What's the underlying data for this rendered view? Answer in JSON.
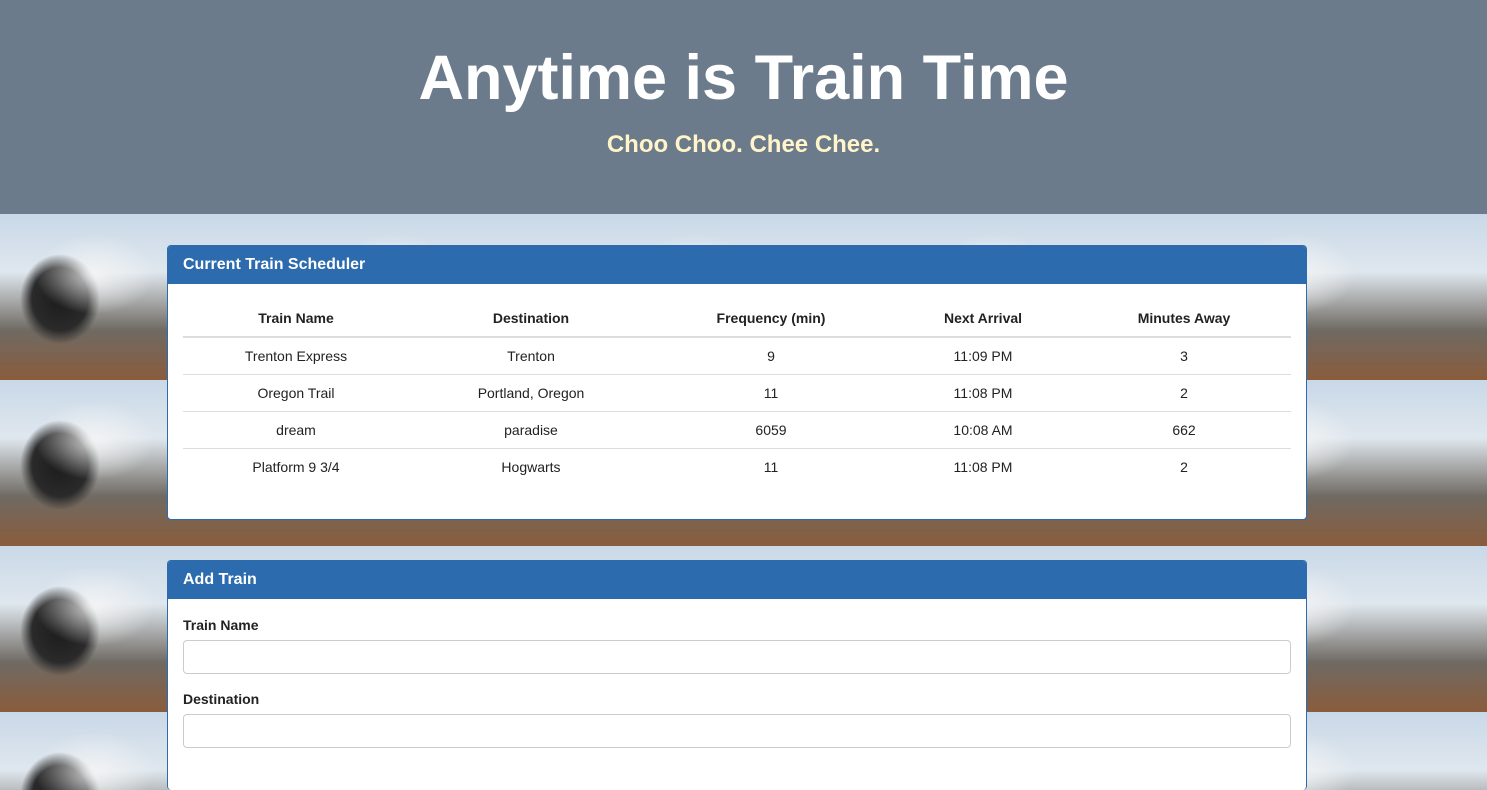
{
  "header": {
    "title": "Anytime is Train Time",
    "subtitle": "Choo Choo. Chee Chee."
  },
  "schedule": {
    "heading": "Current Train Scheduler",
    "columns": [
      "Train Name",
      "Destination",
      "Frequency (min)",
      "Next Arrival",
      "Minutes Away"
    ],
    "rows": [
      [
        "Trenton Express",
        "Trenton",
        "9",
        "11:09 PM",
        "3"
      ],
      [
        "Oregon Trail",
        "Portland, Oregon",
        "11",
        "11:08 PM",
        "2"
      ],
      [
        "dream",
        "paradise",
        "6059",
        "10:08 AM",
        "662"
      ],
      [
        "Platform 9 3/4",
        "Hogwarts",
        "11",
        "11:08 PM",
        "2"
      ]
    ]
  },
  "add_train": {
    "heading": "Add Train",
    "train_name_label": "Train Name",
    "train_name_value": "",
    "destination_label": "Destination",
    "destination_value": ""
  },
  "colors": {
    "header_bg": "#6b7b8c",
    "panel_heading_bg": "#2c6bad",
    "subtitle": "#fff5c9"
  }
}
